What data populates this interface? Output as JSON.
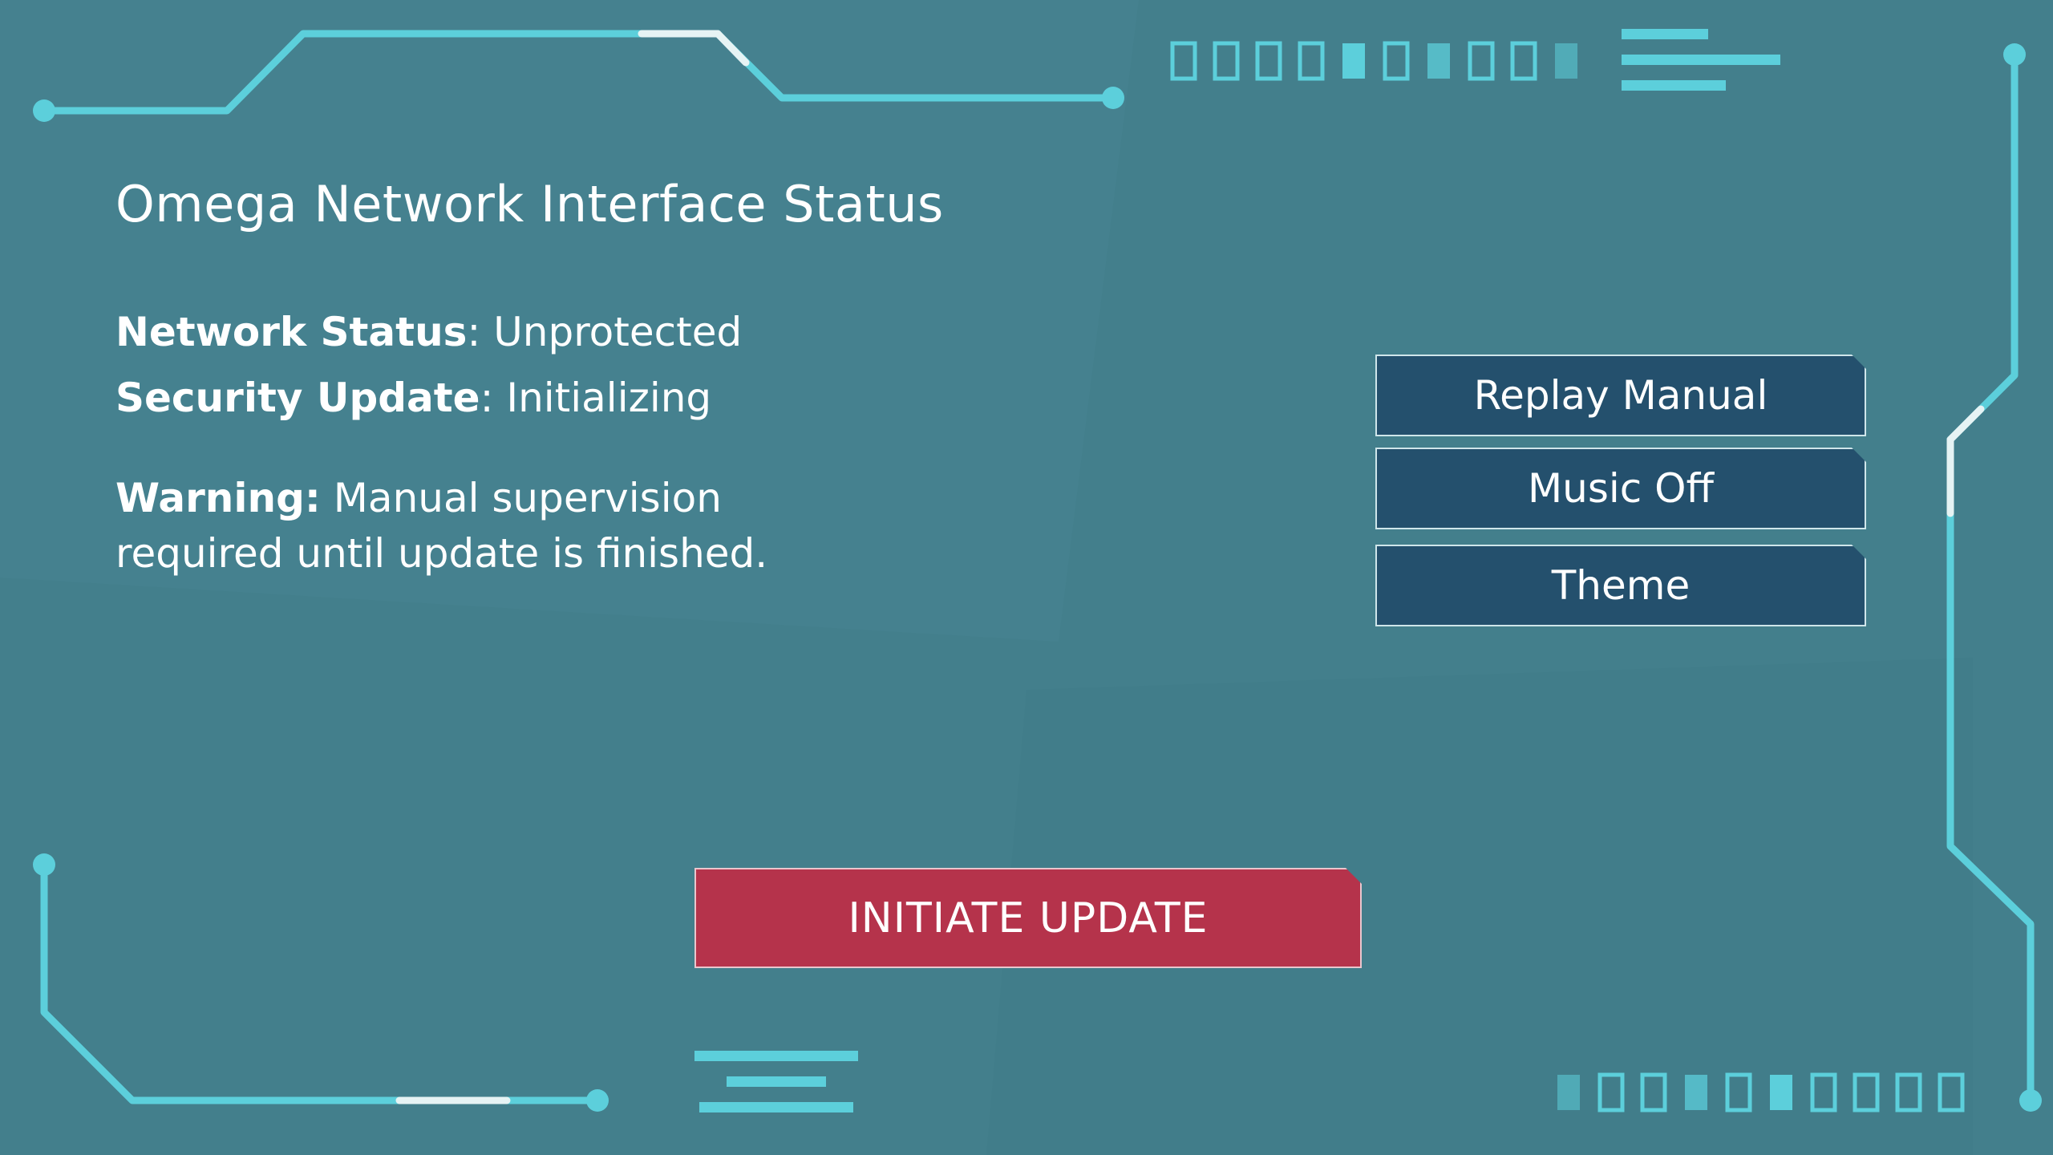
{
  "screen": {
    "title": "Omega Network Interface Status"
  },
  "status": {
    "network_label": "Network Status",
    "network_value": "Unprotected",
    "security_label": "Security Update",
    "security_value": "Initializing",
    "warning_label": "Warning:",
    "warning_text": "Manual supervision required until update is finished."
  },
  "menu": {
    "replay_manual": "Replay Manual",
    "music_off": "Music Off",
    "theme": "Theme"
  },
  "actions": {
    "initiate_update": "INITIATE UPDATE"
  },
  "colors": {
    "background": "#437f8c",
    "accent_cyan": "#5ccfdb",
    "button_dark": "#24506d",
    "button_primary": "#b5334b"
  }
}
